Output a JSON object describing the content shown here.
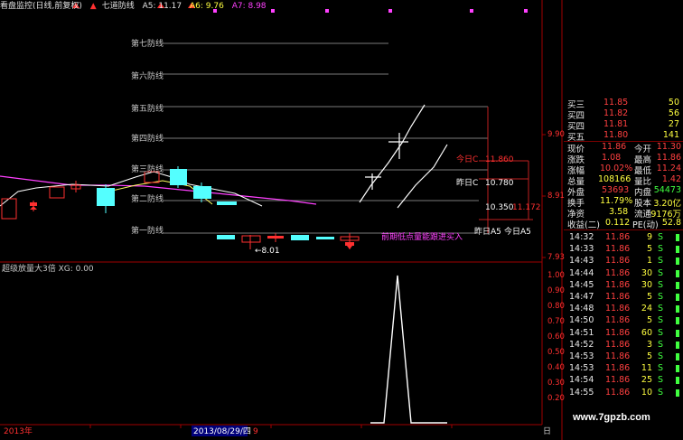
{
  "legend": {
    "indicator_name": "看盘监控(日线,前复权)",
    "line_name": "七道防线",
    "a5_label": "A5: 11.17",
    "a6_label": "A6: 9.76",
    "a7_label": "A7: 8.98"
  },
  "defense_lines": [
    "第七防线",
    "第六防线",
    "第五防线",
    "第四防线",
    "第三防线",
    "第二防线",
    "第一防线"
  ],
  "annotations": {
    "today_c": "今日C",
    "yest_c": "昨日C",
    "today_c_val": "11.860",
    "yest_c_val": "10.780",
    "val_10350": "10.350",
    "val_11172": "11.172",
    "yest_a5": "昨日A5",
    "today_a5": "今日A5",
    "min_price": "8.01",
    "note": "前期低点量能跟进买入"
  },
  "price_axis": [
    "9.90",
    "8.91",
    "7.93"
  ],
  "volume_axis": [
    "1.00",
    "0.90",
    "0.80",
    "0.70",
    "0.60",
    "0.50",
    "0.40",
    "0.30",
    "0.20"
  ],
  "sub_legend": "超级放量大3倍  XG: 0.00",
  "bottom": {
    "year": "2013年",
    "date": "2013/08/29/四",
    "num": "9",
    "right": "日"
  },
  "quote_top": [
    {
      "label": "买三",
      "price": "11.85",
      "vol": "50"
    },
    {
      "label": "买四",
      "price": "11.82",
      "vol": "56"
    },
    {
      "label": "买四",
      "price": "11.81",
      "vol": "27"
    },
    {
      "label": "买五",
      "price": "11.80",
      "vol": "141"
    }
  ],
  "stats": [
    {
      "l1": "现价",
      "v1": "11.86",
      "l2": "今开",
      "v2": "11.30"
    },
    {
      "l1": "涨跌",
      "v1": "1.08",
      "l2": "最高",
      "v2": "11.86"
    },
    {
      "l1": "涨幅",
      "v1": "10.02%",
      "l2": "最低",
      "v2": "11.24"
    },
    {
      "l1": "总量",
      "v1": "108166",
      "l2": "量比",
      "v2": "1.42"
    },
    {
      "l1": "外盘",
      "v1": "53693",
      "l2": "内盘",
      "v2": "54473"
    },
    {
      "l1": "换手",
      "v1": "11.79%",
      "l2": "股本",
      "v2": "3.20亿"
    },
    {
      "l1": "净资",
      "v1": "3.58",
      "l2": "流通",
      "v2": "9176万"
    },
    {
      "l1": "收益(二)",
      "v1": "0.112",
      "l2": "PE(动)",
      "v2": "52.8"
    }
  ],
  "ticks": [
    {
      "t": "14:32",
      "p": "11.86",
      "v": "9",
      "s": "S"
    },
    {
      "t": "14:33",
      "p": "11.86",
      "v": "5",
      "s": "S"
    },
    {
      "t": "14:43",
      "p": "11.86",
      "v": "1",
      "s": "S"
    },
    {
      "t": "14:44",
      "p": "11.86",
      "v": "30",
      "s": "S"
    },
    {
      "t": "14:45",
      "p": "11.86",
      "v": "30",
      "s": "S"
    },
    {
      "t": "14:47",
      "p": "11.86",
      "v": "5",
      "s": "S"
    },
    {
      "t": "14:48",
      "p": "11.86",
      "v": "24",
      "s": "S"
    },
    {
      "t": "14:50",
      "p": "11.86",
      "v": "5",
      "s": "S"
    },
    {
      "t": "14:51",
      "p": "11.86",
      "v": "60",
      "s": "S"
    },
    {
      "t": "14:52",
      "p": "11.86",
      "v": "3",
      "s": "S"
    },
    {
      "t": "14:53",
      "p": "11.86",
      "v": "5",
      "s": "S"
    },
    {
      "t": "14:53",
      "p": "11.86",
      "v": "11",
      "s": "S"
    },
    {
      "t": "14:54",
      "p": "11.86",
      "v": "25",
      "s": "S"
    },
    {
      "t": "14:55",
      "p": "11.86",
      "v": "10",
      "s": "S"
    }
  ],
  "watermark": "www.7gpzb.com",
  "colors": {
    "up": "#ff3030",
    "down": "#54ffff",
    "bg": "#000000",
    "axis": "#a00000",
    "ma": "#ff40ff"
  }
}
